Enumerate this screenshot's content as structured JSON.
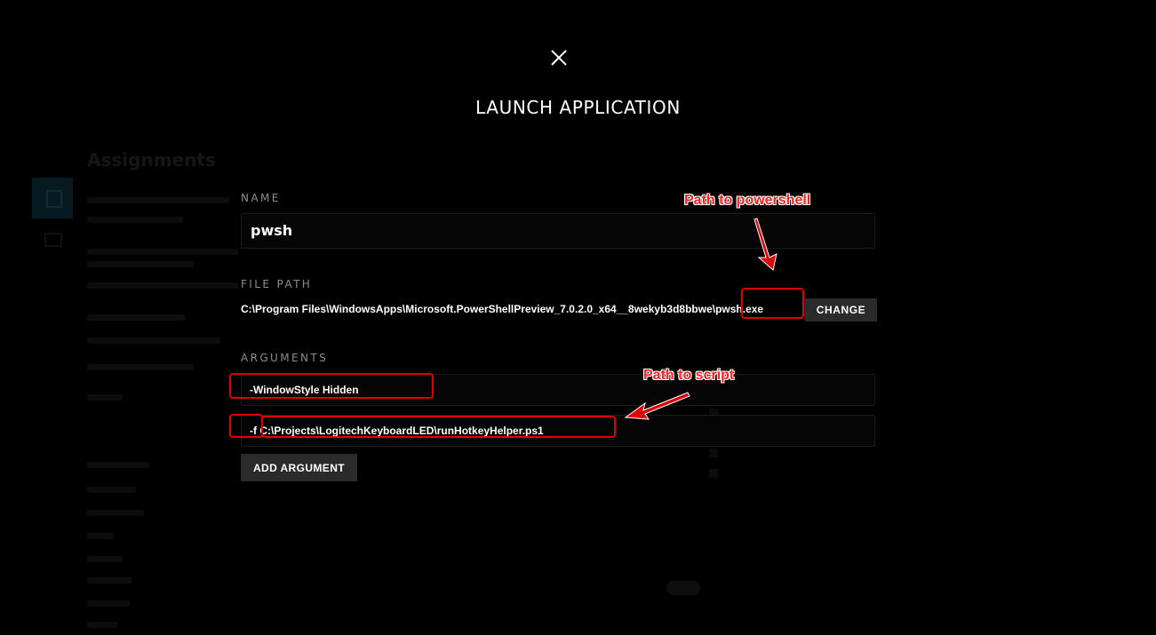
{
  "dialog": {
    "title": "LAUNCH APPLICATION",
    "name_label": "NAME",
    "name_value": "pwsh",
    "file_path_label": "FILE PATH",
    "file_path_value": "C:\\Program Files\\WindowsApps\\Microsoft.PowerShellPreview_7.0.2.0_x64__8wekyb3d8bbwe\\pwsh.exe",
    "change_label": "CHANGE",
    "arguments_label": "ARGUMENTS",
    "arguments": [
      "-WindowStyle Hidden",
      "-f C:\\Projects\\LogitechKeyboardLED\\runHotkeyHelper.ps1"
    ],
    "add_argument_label": "ADD ARGUMENT",
    "close_icon": "close-icon"
  },
  "background": {
    "title": "Assignments"
  },
  "annotations": {
    "powershell_note": "Path to powershell",
    "script_note": "Path to script",
    "color": "#e00000"
  }
}
